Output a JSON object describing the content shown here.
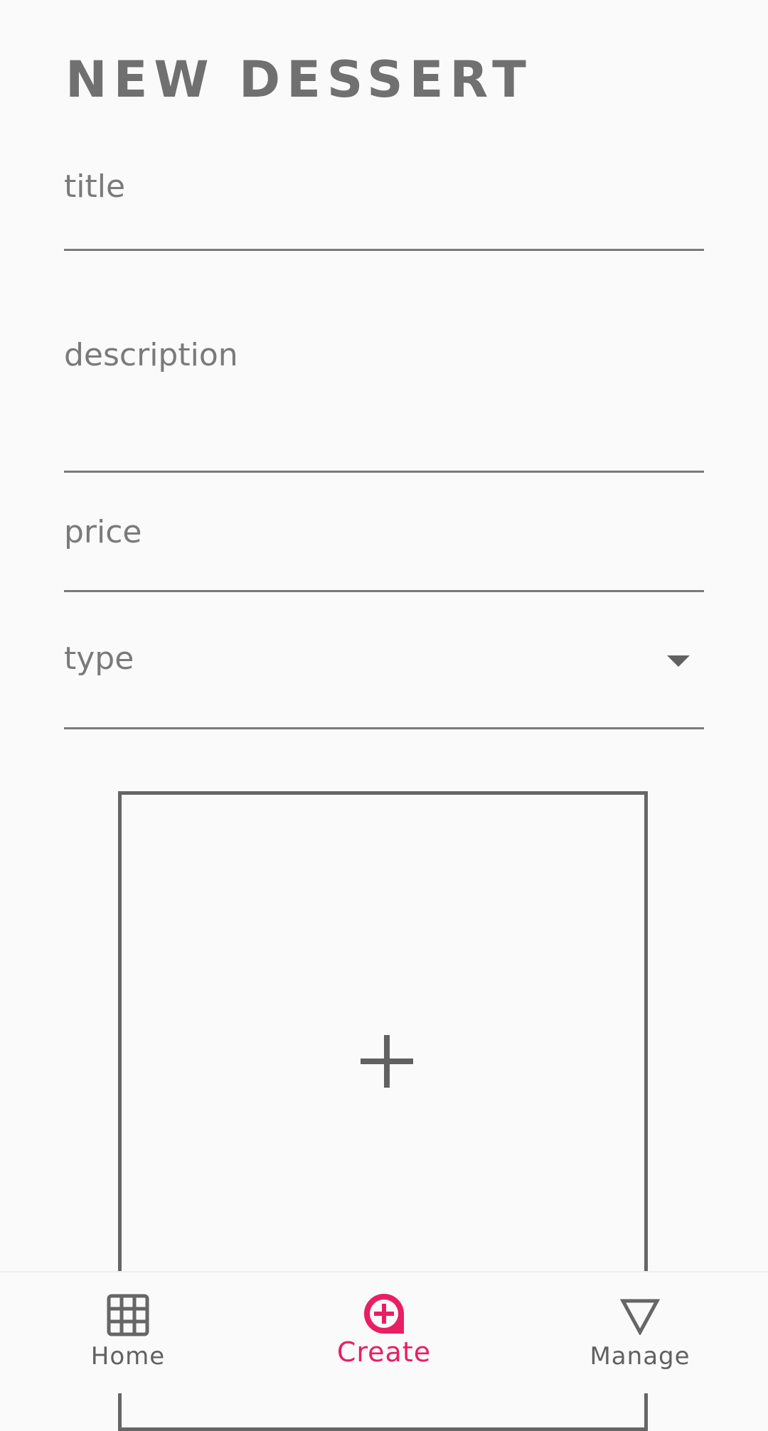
{
  "header": {
    "title": "NEW DESSERT"
  },
  "form": {
    "title_placeholder": "title",
    "description_placeholder": "description",
    "price_placeholder": "price",
    "type_placeholder": "type"
  },
  "image_picker": {
    "icon": "plus-icon"
  },
  "bottom_nav": {
    "items": [
      {
        "label": "Home",
        "icon": "grid-icon",
        "active": false
      },
      {
        "label": "Create",
        "icon": "add-circle-icon",
        "active": true
      },
      {
        "label": "Manage",
        "icon": "triangle-down-icon",
        "active": false
      }
    ]
  },
  "colors": {
    "accent": "#e91e63",
    "text": "#757575",
    "background": "#fafafa"
  }
}
